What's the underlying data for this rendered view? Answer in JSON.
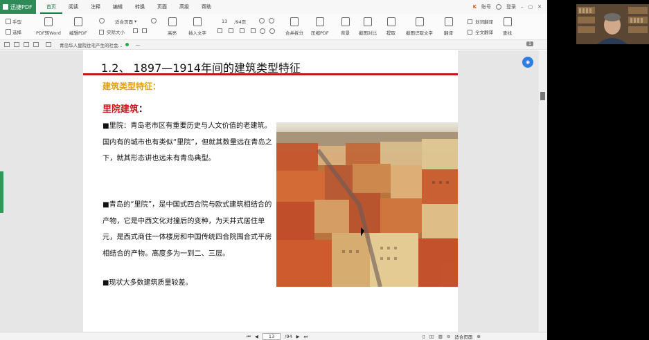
{
  "app": {
    "name": "迅捷PDF",
    "menu": [
      "首页",
      "阅读",
      "注释",
      "编辑",
      "转换",
      "页面",
      "高级",
      "帮助"
    ],
    "account": {
      "vip": "K",
      "vip_label": "账号",
      "login": "登录"
    }
  },
  "toolbar": {
    "hand": "手型",
    "select": "选择",
    "pdf_to_word": "PDF转Word",
    "edit_pdf": "编辑PDF",
    "zoom_value": "适合页面",
    "actual_size": "实际大小",
    "highlight": "高亮",
    "insert_text": "插入文字",
    "page_now": "13",
    "page_total": "/94页",
    "merge_split": "合并拆分",
    "compress_pdf": "压缩PDF",
    "background": "背景",
    "compare": "截图对比",
    "extract": "提取",
    "ocr": "截图识取文字",
    "translate_label": "翻译",
    "translate_partial": "划词翻译",
    "translate_full": "全文翻译",
    "find": "查找"
  },
  "tabbar": {
    "doc_title": "青岛华人里院住宅产生的社会...",
    "page_badge": "1"
  },
  "document": {
    "heading": "1.2、 1897—1914年间的建筑类型特征",
    "subheading": "建筑类型特征：",
    "section_title": "里院建筑",
    "section_colon": "：",
    "para1": "■里院：青岛老市区有重要历史与人文价值的老建筑。国内有的城市也有类似“里院”，但就其数量远在青岛之下，就其形态讲也远未有青岛典型。",
    "para2": "■青岛的“里院”，是中国式四合院与欧式建筑相结合的产物，它是中西文化对撞后的变种，为天井式居住单元，是西式商住一体楼房和中国传统四合院围合式平房相结合的产物。高度多为一到二、三层。",
    "para3": "■现状大多数建筑质量较差。"
  },
  "statusbar": {
    "page_now": "13",
    "page_total": "/94",
    "zoom": "适合页面"
  },
  "colors": {
    "brand": "#2e8b57",
    "heading_rule": "#c4161c",
    "subheading": "#e6a100",
    "section_title": "#c4161c"
  }
}
